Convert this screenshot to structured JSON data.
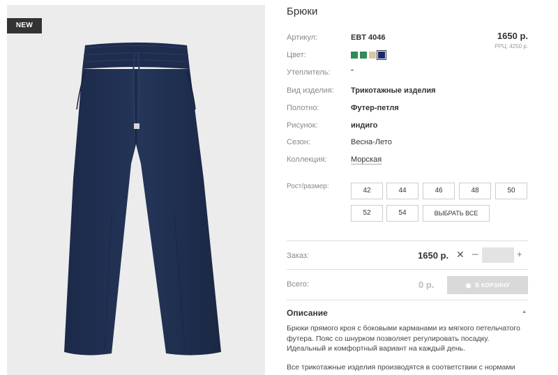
{
  "product": {
    "title": "Брюки",
    "badge": "NEW",
    "price": "1650 р.",
    "rrp": "РРЦ: 4250 р.",
    "attributes": [
      {
        "label": "Артикул:",
        "value": "EBT 4046"
      },
      {
        "label": "Цвет:",
        "value": ""
      },
      {
        "label": "Утеплитель:",
        "value": "\""
      },
      {
        "label": "Вид изделия:",
        "value": "Трикотажные изделия"
      },
      {
        "label": "Полотно:",
        "value": "Футер-петля"
      },
      {
        "label": "Рисунок:",
        "value": "индиго"
      },
      {
        "label": "Сезон:",
        "value": "Весна-Лето"
      },
      {
        "label": "Коллекция:",
        "value": "Морская"
      }
    ],
    "colors": [
      "#2e8b57",
      "#2e8b57",
      "#d8c9a6",
      "#1a2a6c"
    ],
    "selected_color_index": 3
  },
  "sizes": {
    "label": "Рост/размер:",
    "options": [
      "42",
      "44",
      "46",
      "48",
      "50",
      "52",
      "54"
    ],
    "select_all": "ВЫБРАТЬ ВСЕ"
  },
  "order": {
    "label": "Заказ:",
    "price": "1650 р.",
    "quantity": ""
  },
  "total": {
    "label": "Всего:",
    "value": "0 р.",
    "cart_button": "В КОРЗИНУ"
  },
  "description": {
    "title": "Описание",
    "text": "Брюки прямого кроя с боковыми карманами из мягкого петельчатого футера. Пояс со шнурком позволяет регулировать посадку. Идеальный и комфортный вариант на каждый день.",
    "text2": "Все трикотажные изделия производятся в соответствии с нормами"
  },
  "icons": {
    "clear": "close-icon",
    "minus": "minus-icon",
    "plus": "plus-icon",
    "cart": "basket-icon",
    "collapse": "chevron-up-icon"
  }
}
